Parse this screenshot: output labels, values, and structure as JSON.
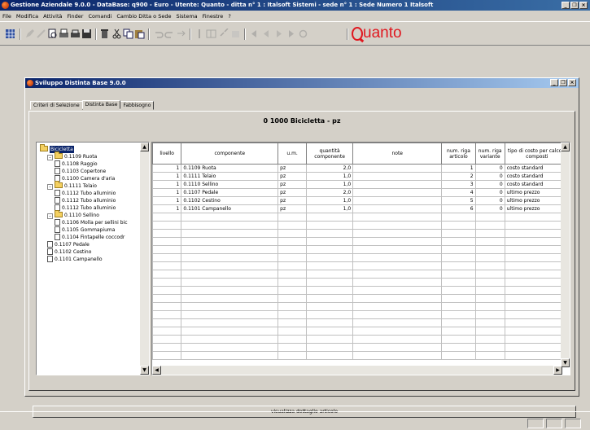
{
  "app": {
    "title": "Gestione Aziendale 9.0.0 - DataBase: q900 - Euro - Utente: Quanto - ditta n° 1 : Italsoft Sistemi - sede n° 1 : Sede Numero 1 Italsoft"
  },
  "menu": [
    "File",
    "Modifica",
    "Attività",
    "Finder",
    "Comandi",
    "Cambio Ditta o Sede",
    "Sistema",
    "Finestre",
    "?"
  ],
  "brand": {
    "logo_text": "uanto"
  },
  "child_window": {
    "title": "Sviluppo Distinta Base 9.0.0",
    "tabs": [
      "Criteri di Selezione",
      "Distinta Base",
      "Fabbisogno"
    ],
    "active_tab": "Distinta Base",
    "header": "0 1000 Bicicletta  - pz",
    "button_label": "visualizza dettaglio articolo"
  },
  "tree": [
    {
      "label": "Bicicletta",
      "level": 0,
      "type": "folder",
      "toggle": "",
      "selected": true
    },
    {
      "label": "0.1109 Ruota",
      "level": 1,
      "type": "folder",
      "toggle": "-"
    },
    {
      "label": "0.1108 Raggio",
      "level": 2,
      "type": "doc"
    },
    {
      "label": "0.1103 Copertone",
      "level": 2,
      "type": "doc"
    },
    {
      "label": "0.1100 Camera d'aria",
      "level": 2,
      "type": "doc"
    },
    {
      "label": "0.1111 Telaio",
      "level": 1,
      "type": "folder",
      "toggle": "-"
    },
    {
      "label": "0.1112 Tubo alluminio",
      "level": 2,
      "type": "doc"
    },
    {
      "label": "0.1112 Tubo alluminio",
      "level": 2,
      "type": "doc"
    },
    {
      "label": "0.1112 Tubo alluminio",
      "level": 2,
      "type": "doc"
    },
    {
      "label": "0.1110 Sellino",
      "level": 1,
      "type": "folder",
      "toggle": "-"
    },
    {
      "label": "0.1106 Molla per sellini bic",
      "level": 2,
      "type": "doc"
    },
    {
      "label": "0.1105 Gommapiuma",
      "level": 2,
      "type": "doc"
    },
    {
      "label": "0.1104 Fintapelle coccodr",
      "level": 2,
      "type": "doc"
    },
    {
      "label": "0.1107 Pedale",
      "level": 1,
      "type": "doc"
    },
    {
      "label": "0.1102 Cestino",
      "level": 1,
      "type": "doc"
    },
    {
      "label": "0.1101 Campanello",
      "level": 1,
      "type": "doc"
    }
  ],
  "grid": {
    "columns": [
      "livello",
      "componente",
      "u.m.",
      "quantità componente",
      "note",
      "num. riga articolo",
      "num. riga variante",
      "tipo di costo per calcolo composti"
    ],
    "rows": [
      [
        "1",
        "0.1109 Ruota",
        "pz",
        "2,0",
        "",
        "1",
        "0",
        "costo standard"
      ],
      [
        "1",
        "0.1111 Telaio",
        "pz",
        "1,0",
        "",
        "2",
        "0",
        "costo standard"
      ],
      [
        "1",
        "0.1110 Sellino",
        "pz",
        "1,0",
        "",
        "3",
        "0",
        "costo standard"
      ],
      [
        "1",
        "0.1107 Pedale",
        "pz",
        "2,0",
        "",
        "4",
        "0",
        "ultimo prezzo"
      ],
      [
        "1",
        "0.1102 Cestino",
        "pz",
        "1,0",
        "",
        "5",
        "0",
        "ultimo prezzo"
      ],
      [
        "1",
        "0.1101 Campanello",
        "pz",
        "1,0",
        "",
        "6",
        "0",
        "ultimo prezzo"
      ]
    ]
  },
  "colors": {
    "title_bar": "#0a246a",
    "logo": "#e01820",
    "face": "#d4d0c8"
  }
}
